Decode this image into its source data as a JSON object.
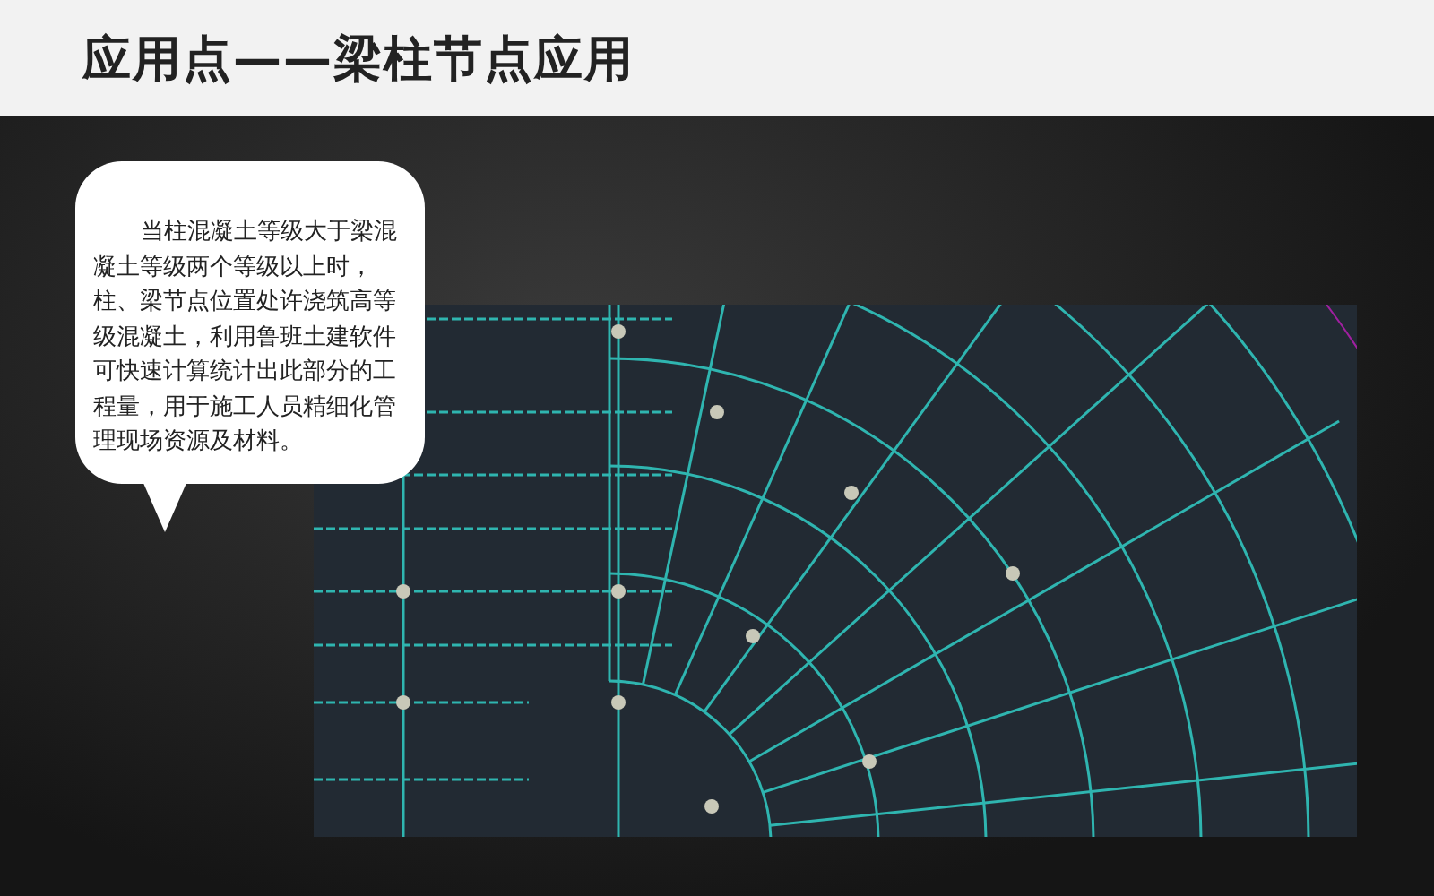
{
  "title": "应用点——梁柱节点应用",
  "callout": {
    "text": "当柱混凝土等级大于梁混凝土等级两个等级以上时，柱、梁节点位置处许浇筑高等级混凝土，利用鲁班土建软件可快速计算统计出此部分的工程量，用于施工人员精细化管理现场资源及材料。"
  }
}
